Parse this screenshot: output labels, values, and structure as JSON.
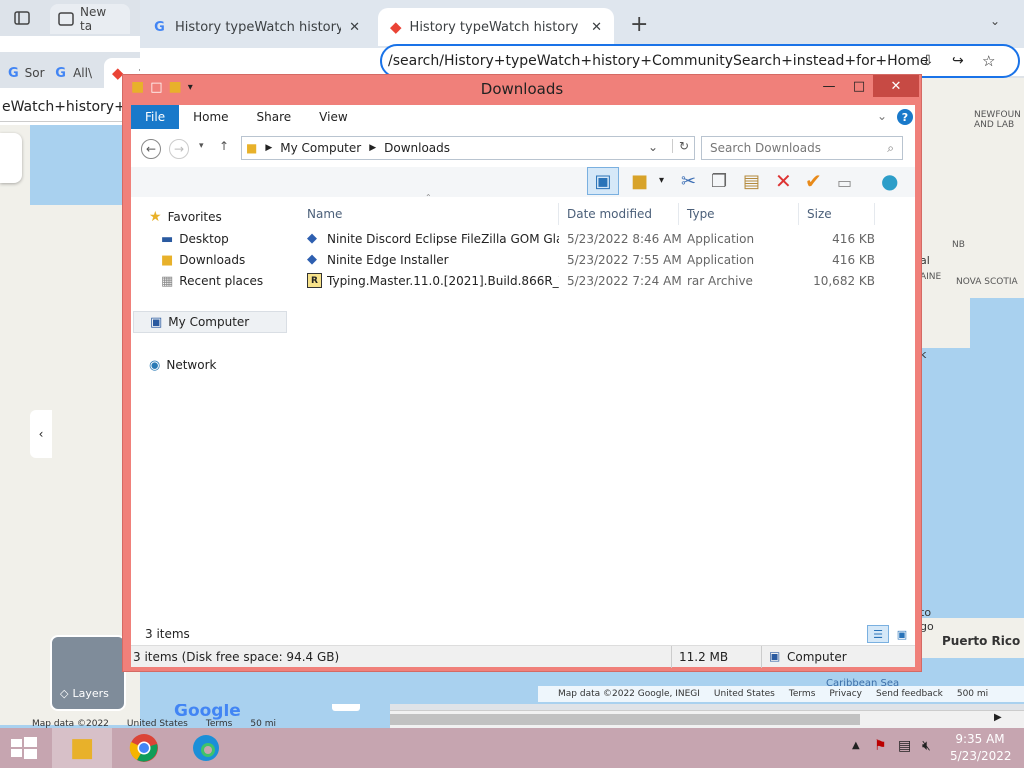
{
  "back_browser": {
    "tab1_title": "New ta",
    "tab2_title": "Sor",
    "tab3_title": "All\\",
    "omnibox_text": "eWatch+history+Co",
    "layers_label": "Layers",
    "google_logo": "Google",
    "map_footer": [
      "Map data ©2022",
      "United States",
      "Terms",
      "50 mi"
    ],
    "privacy": "Privacy   Send feedback"
  },
  "browser": {
    "tabs": [
      {
        "title": "History typeWatch history Comm",
        "icon": "google-g-icon",
        "active": false
      },
      {
        "title": "History typeWatch history Comm",
        "icon": "maps-pin-icon",
        "active": true
      }
    ],
    "omnibox_text": "/search/History+typeWatch+history+CommunitySearch+instead+for+HomeExplor...",
    "map_labels": {
      "newfoundland": "NEWFOUN AND LAB",
      "nb": "NB",
      "nova_scotia": "NOVA SCOTIA",
      "maine": "AINE",
      "al": "al",
      "k": "k",
      "to": "to",
      "go": "go",
      "puerto_rico": "Puerto Rico",
      "caribbean": "Caribbean Sea"
    },
    "map_footer": [
      "Map data ©2022 Google, INEGI",
      "United States",
      "Terms",
      "Privacy",
      "Send feedback",
      "500 mi"
    ]
  },
  "explorer": {
    "title": "Downloads",
    "ribbon_tabs": [
      "File",
      "Home",
      "Share",
      "View"
    ],
    "breadcrumb": [
      "My Computer",
      "Downloads"
    ],
    "search_placeholder": "Search Downloads",
    "nav": {
      "favorites": "Favorites",
      "desktop": "Desktop",
      "downloads": "Downloads",
      "recent": "Recent places",
      "computer": "My Computer",
      "network": "Network"
    },
    "columns": [
      "Name",
      "Date modified",
      "Type",
      "Size"
    ],
    "files": [
      {
        "name": "Ninite Discord Eclipse FileZilla GOM Glar...",
        "date": "5/23/2022 8:46 AM",
        "type": "Application",
        "size": "416 KB",
        "icon": "ninite-icon"
      },
      {
        "name": "Ninite Edge Installer",
        "date": "5/23/2022 7:55 AM",
        "type": "Application",
        "size": "416 KB",
        "icon": "ninite-icon"
      },
      {
        "name": "Typing.Master.11.0.[2021].Build.866R_Yas...",
        "date": "5/23/2022 7:24 AM",
        "type": "rar Archive",
        "size": "10,682 KB",
        "icon": "rar-archive-icon"
      }
    ],
    "item_count": "3 items",
    "status_left": "3 items (Disk free space: 94.4 GB)",
    "status_size": "11.2 MB",
    "status_location": "Computer"
  },
  "taskbar": {
    "time": "9:35 AM",
    "date": "5/23/2022"
  }
}
